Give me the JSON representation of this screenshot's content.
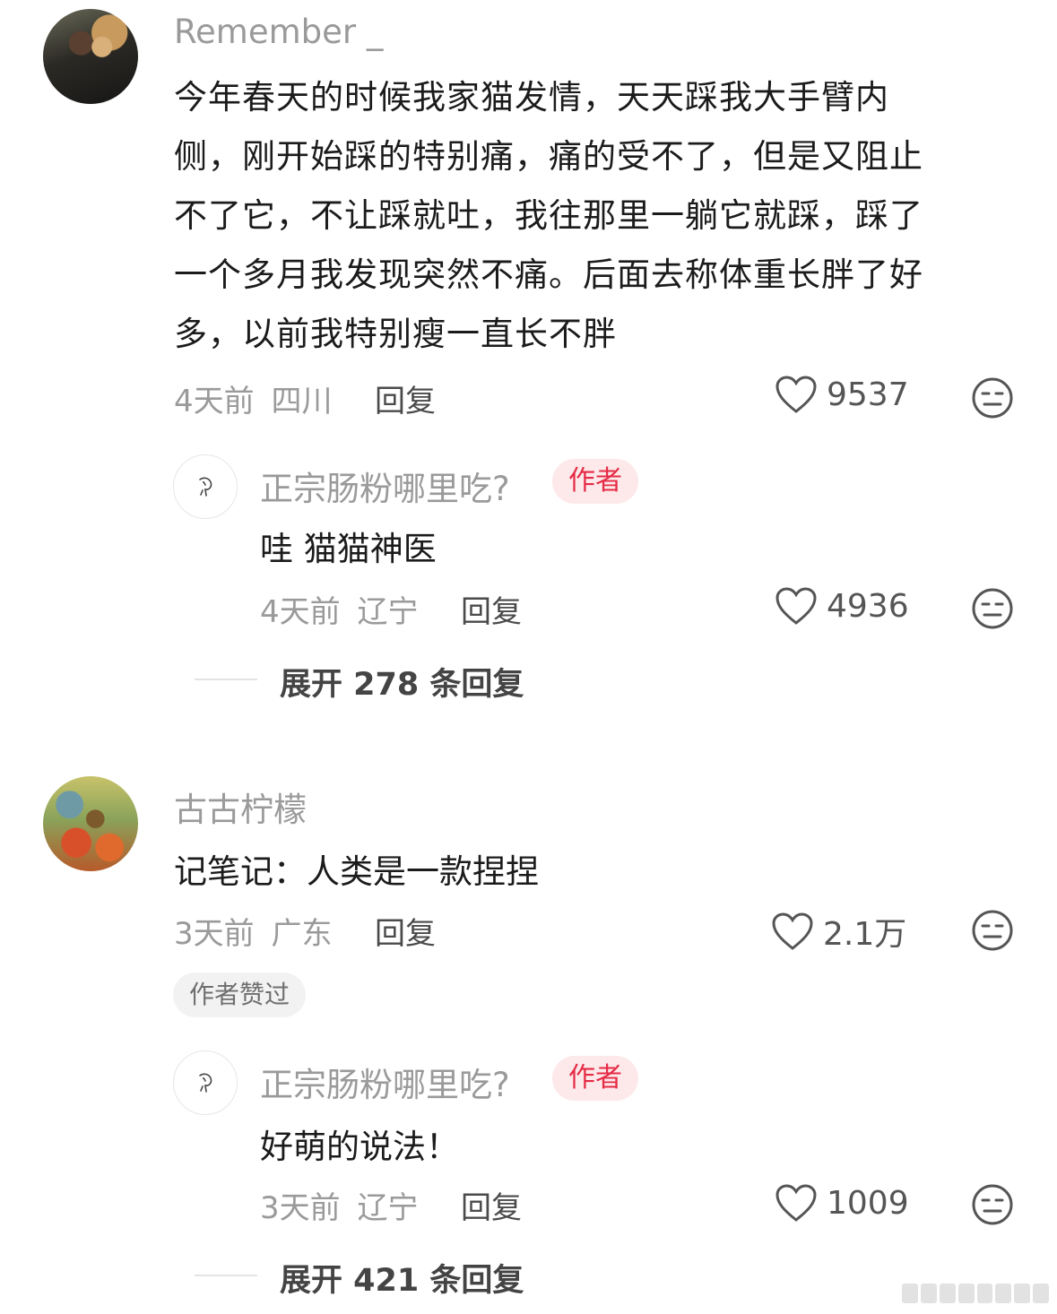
{
  "comments": [
    {
      "username": "Remember _",
      "text_lines": [
        "今年春天的时候我家猫发情，天天踩我大手臂内",
        "侧，刚开始踩的特别痛，痛的受不了，但是又阻止",
        "不了它，不让踩就吐，我往那里一躺它就踩，踩了",
        "一个多月我发现突然不痛。后面去称体重长胖了好",
        "多，以前我特别瘦一直长不胖"
      ],
      "time": "4天前",
      "location": "四川",
      "reply_label": "回复",
      "likes": "9537",
      "reply": {
        "username": "正宗肠粉哪里吃?",
        "author_tag": "作者",
        "text": "哇 猫猫神医",
        "time": "4天前",
        "location": "辽宁",
        "reply_label": "回复",
        "likes": "4936"
      },
      "expand_label": "展开 278 条回复"
    },
    {
      "username": "古古柠檬",
      "text": "记笔记：人类是一款捏捏",
      "time": "3天前",
      "location": "广东",
      "reply_label": "回复",
      "likes": "2.1万",
      "liked_badge": "作者赞过",
      "reply": {
        "username": "正宗肠粉哪里吃?",
        "author_tag": "作者",
        "text": "好萌的说法！",
        "time": "3天前",
        "location": "辽宁",
        "reply_label": "回复",
        "likes": "1009"
      },
      "expand_label": "展开 421 条回复"
    }
  ],
  "icons": {
    "like": "heart-outline-icon",
    "dislike": "neutral-face-icon"
  },
  "colors": {
    "author_tag_bg": "#fde8ea",
    "author_tag_text": "#e52b45",
    "meta_gray": "#9a9a9a"
  }
}
